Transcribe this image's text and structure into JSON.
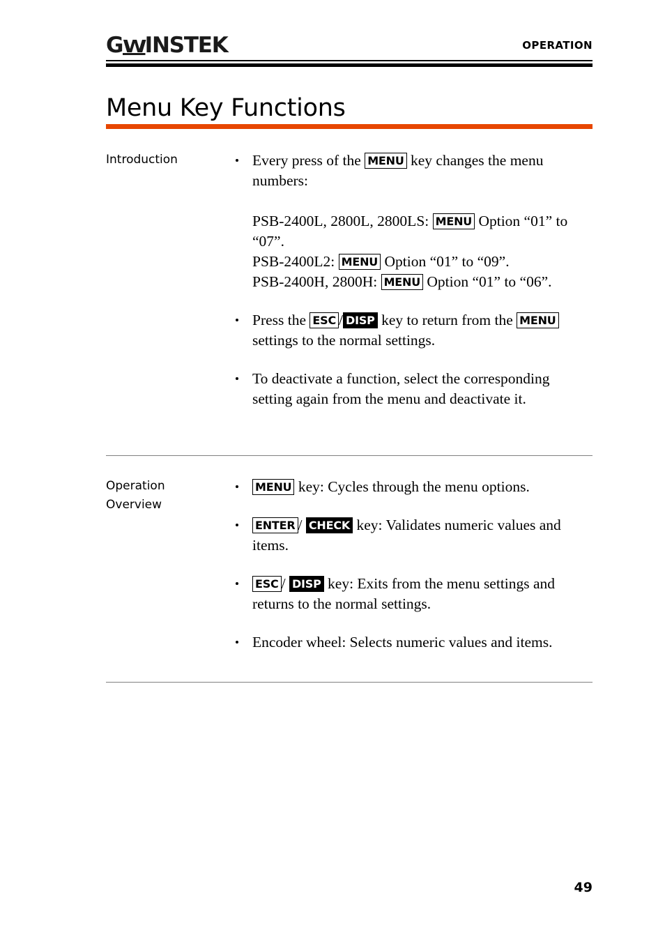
{
  "header": {
    "logo_g": "G",
    "logo_w": "W",
    "logo_rest": "INSTEK",
    "logo_full": "GW INSTEK",
    "chapter": "OPERATION"
  },
  "title": "Menu Key Functions",
  "colors": {
    "title_rule": "#E74600",
    "separator": "#808080",
    "text": "#000000",
    "key_invert_bg": "#000000",
    "key_invert_fg": "#ffffff"
  },
  "sections": [
    {
      "label": "Introduction",
      "bullets": [
        {
          "parts": [
            {
              "type": "text",
              "value": "Every press of the "
            },
            {
              "type": "key",
              "value": "MENU",
              "style": "outline"
            },
            {
              "type": "text",
              "value": " key changes the menu numbers:"
            }
          ],
          "sub_lines": [
            [
              {
                "type": "text",
                "value": "PSB-2400L, 2800L, 2800LS: "
              },
              {
                "type": "key",
                "value": "MENU",
                "style": "outline"
              },
              {
                "type": "text",
                "value": " Option “01” to “07”."
              }
            ],
            [
              {
                "type": "text",
                "value": "PSB-2400L2: "
              },
              {
                "type": "key",
                "value": "MENU",
                "style": "outline"
              },
              {
                "type": "text",
                "value": " Option “01” to “09”."
              }
            ],
            [
              {
                "type": "text",
                "value": "PSB-2400H, 2800H: "
              },
              {
                "type": "key",
                "value": "MENU",
                "style": "outline"
              },
              {
                "type": "text",
                "value": " Option “01” to “06”."
              }
            ]
          ]
        },
        {
          "parts": [
            {
              "type": "text",
              "value": "Press the "
            },
            {
              "type": "key",
              "value": "ESC",
              "style": "outline"
            },
            {
              "type": "text",
              "value": "/"
            },
            {
              "type": "key",
              "value": "DISP",
              "style": "invert"
            },
            {
              "type": "text",
              "value": " key to return from the "
            },
            {
              "type": "key",
              "value": "MENU",
              "style": "outline"
            },
            {
              "type": "text",
              "value": " settings to the normal settings."
            }
          ]
        },
        {
          "parts": [
            {
              "type": "text",
              "value": "To deactivate a function, select the corresponding setting again from the menu and deactivate it."
            }
          ]
        }
      ]
    },
    {
      "label": "Operation Overview",
      "label_line1": "Operation",
      "label_line2": "Overview",
      "bullets": [
        {
          "parts": [
            {
              "type": "key",
              "value": "MENU",
              "style": "outline"
            },
            {
              "type": "text",
              "value": " key: Cycles through the menu options."
            }
          ]
        },
        {
          "parts": [
            {
              "type": "key",
              "value": "ENTER",
              "style": "outline"
            },
            {
              "type": "text",
              "value": "/ "
            },
            {
              "type": "key",
              "value": "CHECK",
              "style": "invert"
            },
            {
              "type": "text",
              "value": " key: Validates numeric values and items."
            }
          ]
        },
        {
          "parts": [
            {
              "type": "key",
              "value": "ESC",
              "style": "outline"
            },
            {
              "type": "text",
              "value": "/ "
            },
            {
              "type": "key",
              "value": "DISP",
              "style": "invert"
            },
            {
              "type": "text",
              "value": " key: Exits from the menu settings and returns to the normal settings."
            }
          ]
        },
        {
          "parts": [
            {
              "type": "text",
              "value": "Encoder wheel: Selects numeric values and items."
            }
          ]
        }
      ]
    }
  ],
  "page_number": "49"
}
